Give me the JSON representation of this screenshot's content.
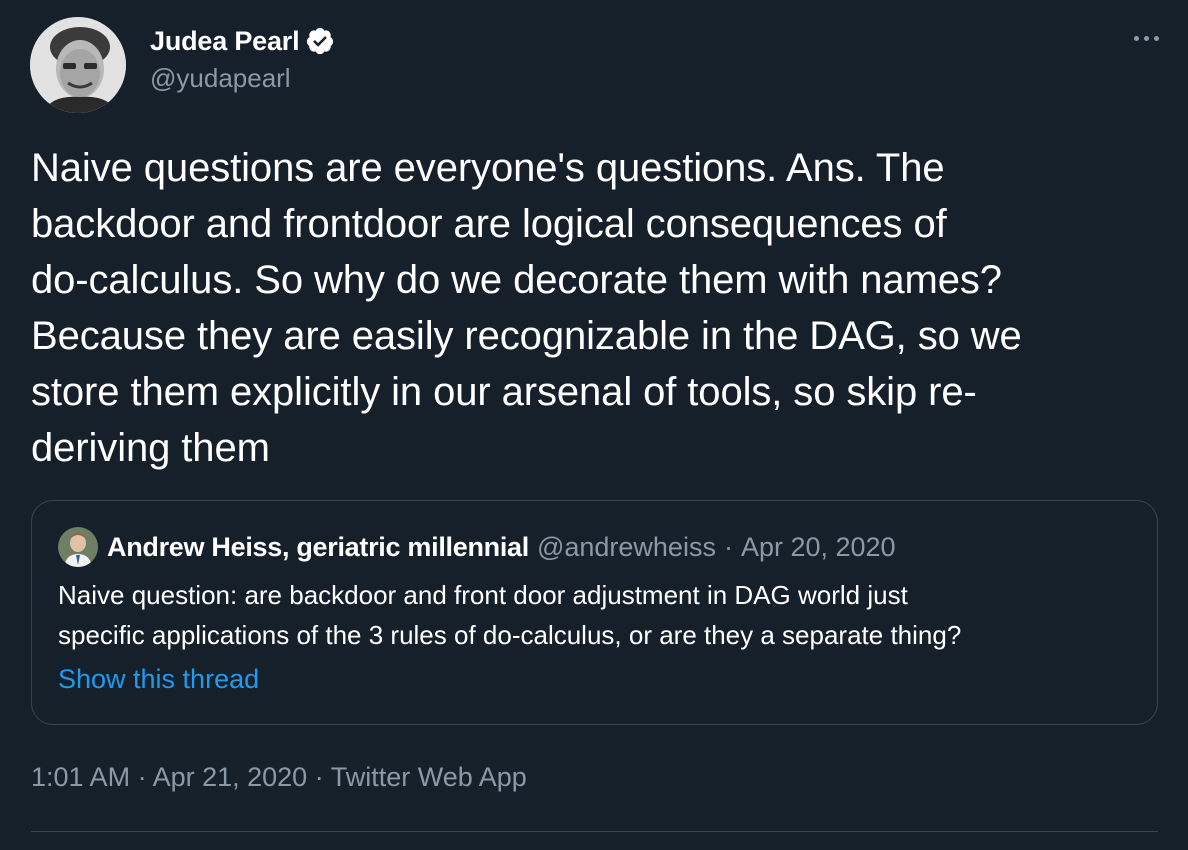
{
  "author": {
    "display_name": "Judea Pearl",
    "handle": "@yudapearl",
    "verified_icon": "verified-badge-icon"
  },
  "tweet": {
    "text": "Naive questions are everyone's questions. Ans. The\nbackdoor and frontdoor are logical consequences of\ndo-calculus. So why do we decorate them with names?\nBecause they are easily recognizable in the DAG, so we\nstore them explicitly in our arsenal of tools, so skip re-\nderiving them"
  },
  "quoted_tweet": {
    "display_name": "Andrew Heiss, geriatric millennial",
    "handle": "@andrewheiss",
    "separator": "·",
    "date": "Apr 20, 2020",
    "text": "Naive question: are backdoor and front door adjustment in DAG world just\nspecific applications of the 3 rules of do-calculus, or are they a separate thing?",
    "show_thread_label": "Show this thread"
  },
  "footer": {
    "time": "1:01 AM",
    "sep1": " · ",
    "date": "Apr 21, 2020",
    "sep2": " · ",
    "source": "Twitter Web App"
  },
  "colors": {
    "background": "#15202b",
    "text": "#ffffff",
    "secondary": "#8b98a5",
    "link": "#1d9bf0",
    "border": "#38444d"
  },
  "icons": {
    "more": "more-horizontal-icon"
  }
}
